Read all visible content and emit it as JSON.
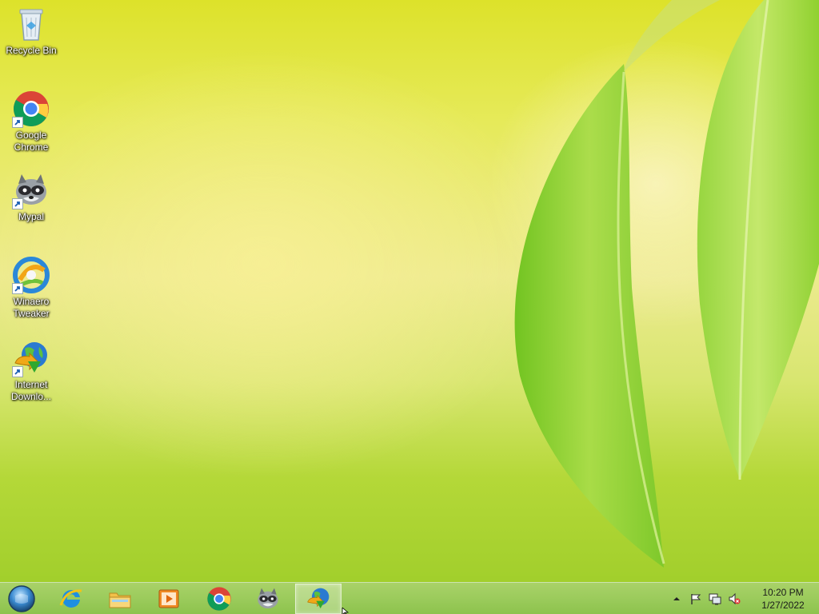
{
  "desktop": {
    "icons": [
      {
        "label": "Recycle Bin",
        "icon": "recycle-bin-icon",
        "shortcut": false
      },
      {
        "label": "Google Chrome",
        "icon": "chrome-icon",
        "shortcut": true
      },
      {
        "label": "Mypal",
        "icon": "mypal-raccoon-icon",
        "shortcut": true
      },
      {
        "label": "Winaero Tweaker",
        "icon": "winaero-tweaker-icon",
        "shortcut": true
      },
      {
        "label": "Internet Downlo...",
        "icon": "internet-download-manager-icon",
        "shortcut": true
      }
    ]
  },
  "taskbar": {
    "start": {
      "icon": "start-orb-icon"
    },
    "pinned": [
      {
        "name": "Internet Explorer",
        "icon": "internet-explorer-icon",
        "active": false
      },
      {
        "name": "File Explorer",
        "icon": "file-explorer-icon",
        "active": false
      },
      {
        "name": "Windows Media Player",
        "icon": "media-player-icon",
        "active": false
      },
      {
        "name": "Google Chrome",
        "icon": "chrome-icon",
        "active": false
      },
      {
        "name": "Mypal",
        "icon": "mypal-raccoon-icon",
        "active": false
      },
      {
        "name": "Internet Download Manager",
        "icon": "internet-download-manager-icon",
        "active": true
      }
    ],
    "tray": {
      "icons": [
        "show-hidden-icons-chevron-icon",
        "action-center-flag-icon",
        "network-icon",
        "volume-muted-icon"
      ],
      "time": "10:20 PM",
      "date": "1/27/2022"
    }
  },
  "colors": {
    "wallpaper_top": "#dde22a",
    "wallpaper_bottom": "#9ccc28",
    "taskbar": "#9cc85a"
  }
}
